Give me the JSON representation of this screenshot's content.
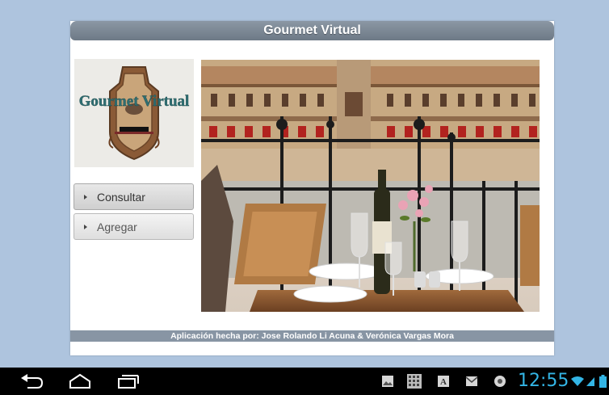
{
  "app": {
    "title": "Gourmet Virtual",
    "logo_text": "Gourmet Virtual",
    "footer_credits": "Aplicación hecha por: Jose Rolando Li Acuna & Verónica Vargas Mora"
  },
  "menu": {
    "items": [
      {
        "label": "Consultar",
        "state": "pressed"
      },
      {
        "label": "Agregar",
        "state": "normal"
      }
    ]
  },
  "hero": {
    "icon": "restaurant-balcony-photo"
  },
  "system_bar": {
    "nav": [
      "back-icon",
      "home-icon",
      "recent-apps-icon"
    ],
    "notifications": [
      "image-notification-icon",
      "keyboard-notification-icon",
      "text-notification-icon",
      "gmail-notification-icon",
      "settings-notification-icon"
    ],
    "clock": "12:55",
    "clock_color": "#33b5e5",
    "status": [
      "wifi-icon",
      "signal-icon",
      "battery-icon"
    ]
  },
  "colors": {
    "background": "#aec4de",
    "title_bar": "#7d8995",
    "footer_bar": "#8895a4"
  }
}
